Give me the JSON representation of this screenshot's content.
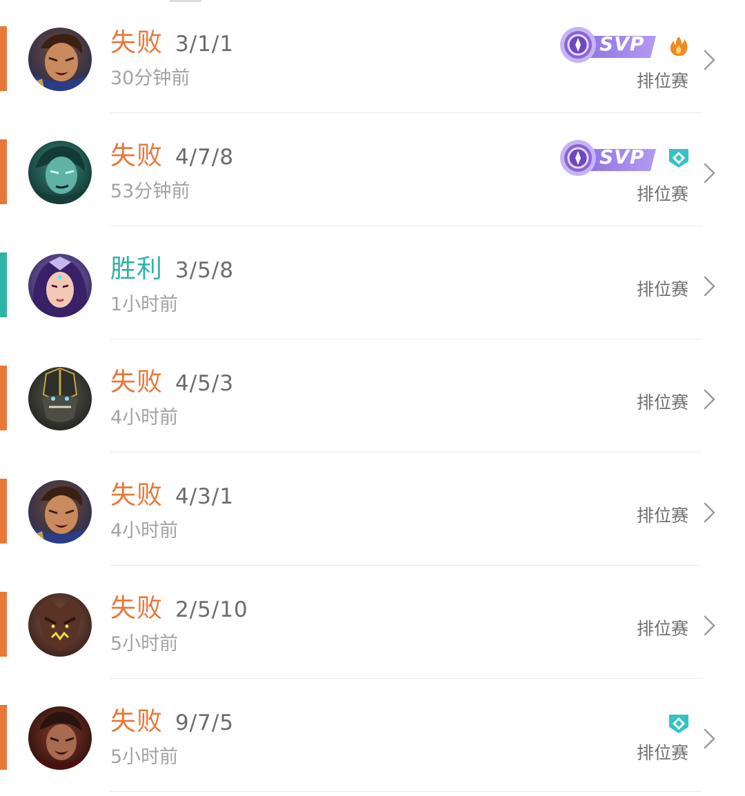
{
  "colors": {
    "loss": "#e8783a",
    "win": "#2fb3a6",
    "svp_purple": "#9a7ae0",
    "tag_teal": "#33c2c7"
  },
  "matches": [
    {
      "result": "失败",
      "kda": "3/1/1",
      "time": "30分钟前",
      "mode": "排位赛",
      "outcome": "loss",
      "svp": "SVP",
      "side_icon": "fire-icon",
      "hero": "hero-1"
    },
    {
      "result": "失败",
      "kda": "4/7/8",
      "time": "53分钟前",
      "mode": "排位赛",
      "outcome": "loss",
      "svp": "SVP",
      "side_icon": "diamond-shield-icon",
      "hero": "hero-2"
    },
    {
      "result": "胜利",
      "kda": "3/5/8",
      "time": "1小时前",
      "mode": "排位赛",
      "outcome": "win",
      "svp": "",
      "side_icon": "",
      "hero": "hero-3"
    },
    {
      "result": "失败",
      "kda": "4/5/3",
      "time": "4小时前",
      "mode": "排位赛",
      "outcome": "loss",
      "svp": "",
      "side_icon": "",
      "hero": "hero-4"
    },
    {
      "result": "失败",
      "kda": "4/3/1",
      "time": "4小时前",
      "mode": "排位赛",
      "outcome": "loss",
      "svp": "",
      "side_icon": "",
      "hero": "hero-1"
    },
    {
      "result": "失败",
      "kda": "2/5/10",
      "time": "5小时前",
      "mode": "排位赛",
      "outcome": "loss",
      "svp": "",
      "side_icon": "",
      "hero": "hero-5"
    },
    {
      "result": "失败",
      "kda": "9/7/5",
      "time": "5小时前",
      "mode": "排位赛",
      "outcome": "loss",
      "svp": "",
      "side_icon": "diamond-shield-icon",
      "hero": "hero-6"
    }
  ]
}
